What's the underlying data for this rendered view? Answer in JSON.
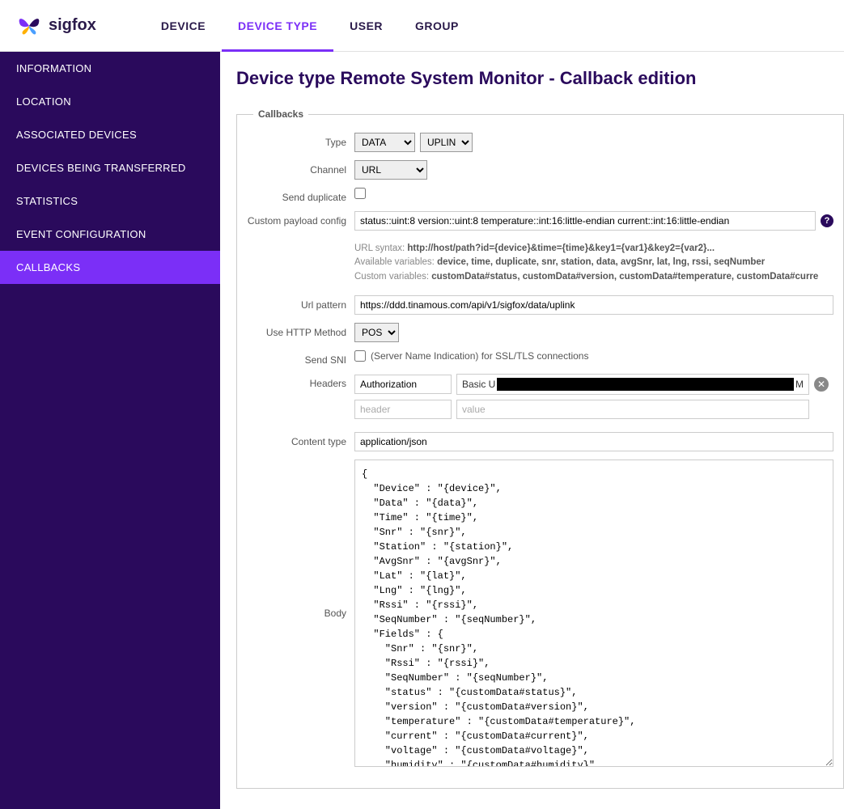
{
  "brand": "sigfox",
  "topnav": [
    {
      "label": "DEVICE",
      "active": false
    },
    {
      "label": "DEVICE TYPE",
      "active": true
    },
    {
      "label": "USER",
      "active": false
    },
    {
      "label": "GROUP",
      "active": false
    }
  ],
  "sidebar": [
    {
      "label": "INFORMATION",
      "active": false
    },
    {
      "label": "LOCATION",
      "active": false
    },
    {
      "label": "ASSOCIATED DEVICES",
      "active": false
    },
    {
      "label": "DEVICES BEING TRANSFERRED",
      "active": false
    },
    {
      "label": "STATISTICS",
      "active": false
    },
    {
      "label": "EVENT CONFIGURATION",
      "active": false
    },
    {
      "label": "CALLBACKS",
      "active": true
    }
  ],
  "page_title": "Device type Remote System Monitor - Callback edition",
  "fieldset_legend": "Callbacks",
  "labels": {
    "type": "Type",
    "channel": "Channel",
    "send_duplicate": "Send duplicate",
    "custom_payload": "Custom payload config",
    "url_pattern": "Url pattern",
    "http_method": "Use HTTP Method",
    "send_sni": "Send SNI",
    "headers": "Headers",
    "content_type": "Content type",
    "body": "Body"
  },
  "values": {
    "type_select": "DATA",
    "direction_select": "UPLINK",
    "channel_select": "URL",
    "send_duplicate": false,
    "custom_payload": "status::uint:8 version::uint:8 temperature::int:16:little-endian current::int:16:little-endian",
    "url_pattern": "https://ddd.tinamous.com/api/v1/sigfox/data/uplink",
    "http_method": "POST",
    "send_sni": false,
    "sni_hint": "(Server Name Indication) for SSL/TLS connections",
    "headers": [
      {
        "name": "Authorization",
        "value_prefix": "Basic U",
        "value_suffix": "M"
      }
    ],
    "header_placeholder_name": "header",
    "header_placeholder_value": "value",
    "content_type": "application/json",
    "body": "{\n  \"Device\" : \"{device}\",\n  \"Data\" : \"{data}\",\n  \"Time\" : \"{time}\",\n  \"Snr\" : \"{snr}\",\n  \"Station\" : \"{station}\",\n  \"AvgSnr\" : \"{avgSnr}\",\n  \"Lat\" : \"{lat}\",\n  \"Lng\" : \"{lng}\",\n  \"Rssi\" : \"{rssi}\",\n  \"SeqNumber\" : \"{seqNumber}\",\n  \"Fields\" : {\n    \"Snr\" : \"{snr}\",\n    \"Rssi\" : \"{rssi}\",\n    \"SeqNumber\" : \"{seqNumber}\",\n    \"status\" : \"{customData#status}\",\n    \"version\" : \"{customData#version}\",\n    \"temperature\" : \"{customData#temperature}\",\n    \"current\" : \"{customData#current}\",\n    \"voltage\" : \"{customData#voltage}\",\n    \"humidity\" : \"{customData#humidity}\",\n    \"light\" : \"{customData#light}\",\n    \"lastStatus\" : \"{customData#lastStatus}\"\n  }\n}"
  },
  "help": {
    "url_syntax_label": "URL syntax: ",
    "url_syntax_value": "http://host/path?id={device}&time={time}&key1={var1}&key2={var2}...",
    "avail_vars_label": "Available variables: ",
    "avail_vars_value": "device, time, duplicate, snr, station, data, avgSnr, lat, lng, rssi, seqNumber",
    "custom_vars_label": "Custom variables: ",
    "custom_vars_value": "customData#status, customData#version, customData#temperature, customData#curre"
  }
}
